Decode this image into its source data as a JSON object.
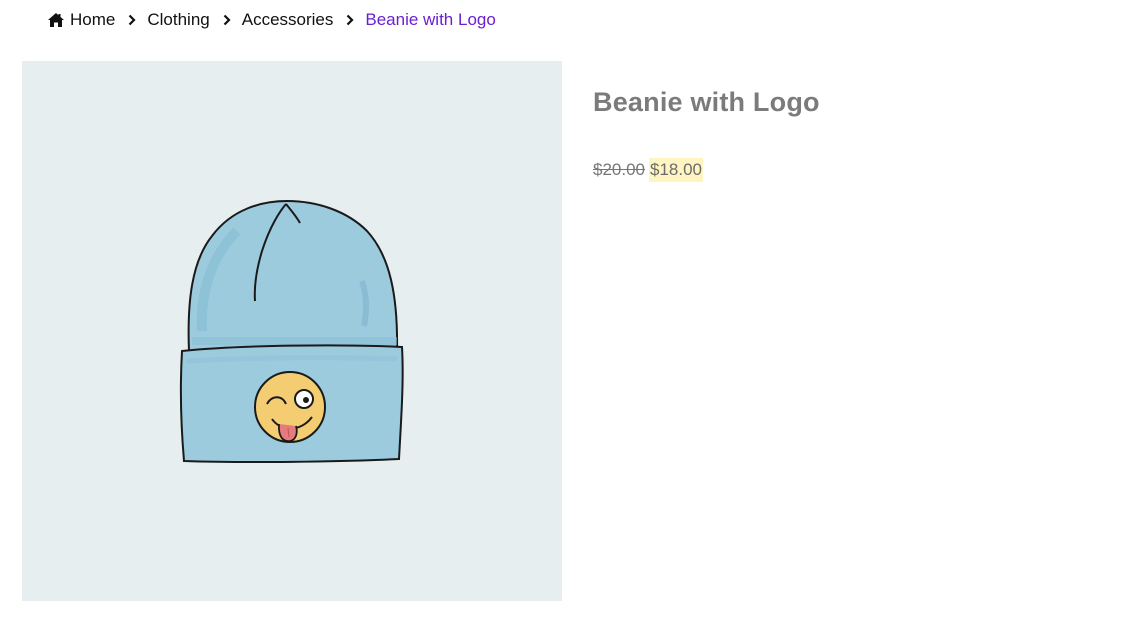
{
  "breadcrumb": {
    "items": [
      {
        "label": "Home",
        "icon": "home-icon"
      },
      {
        "label": "Clothing"
      },
      {
        "label": "Accessories"
      },
      {
        "label": "Beanie with Logo",
        "current": true
      }
    ],
    "separator_icon": "chevron-right-icon"
  },
  "product": {
    "title": "Beanie with Logo",
    "price_regular": "$20.00",
    "price_sale": "$18.00",
    "image_icon": "beanie-with-winking-emoji-illustration"
  },
  "colors": {
    "accent": "#6b1fd1",
    "image_background": "#e6eef0",
    "title": "#7b7b7b",
    "sale_highlight": "#fff5c2",
    "beanie": "#9ccbde",
    "emoji": "#f4cd72"
  }
}
